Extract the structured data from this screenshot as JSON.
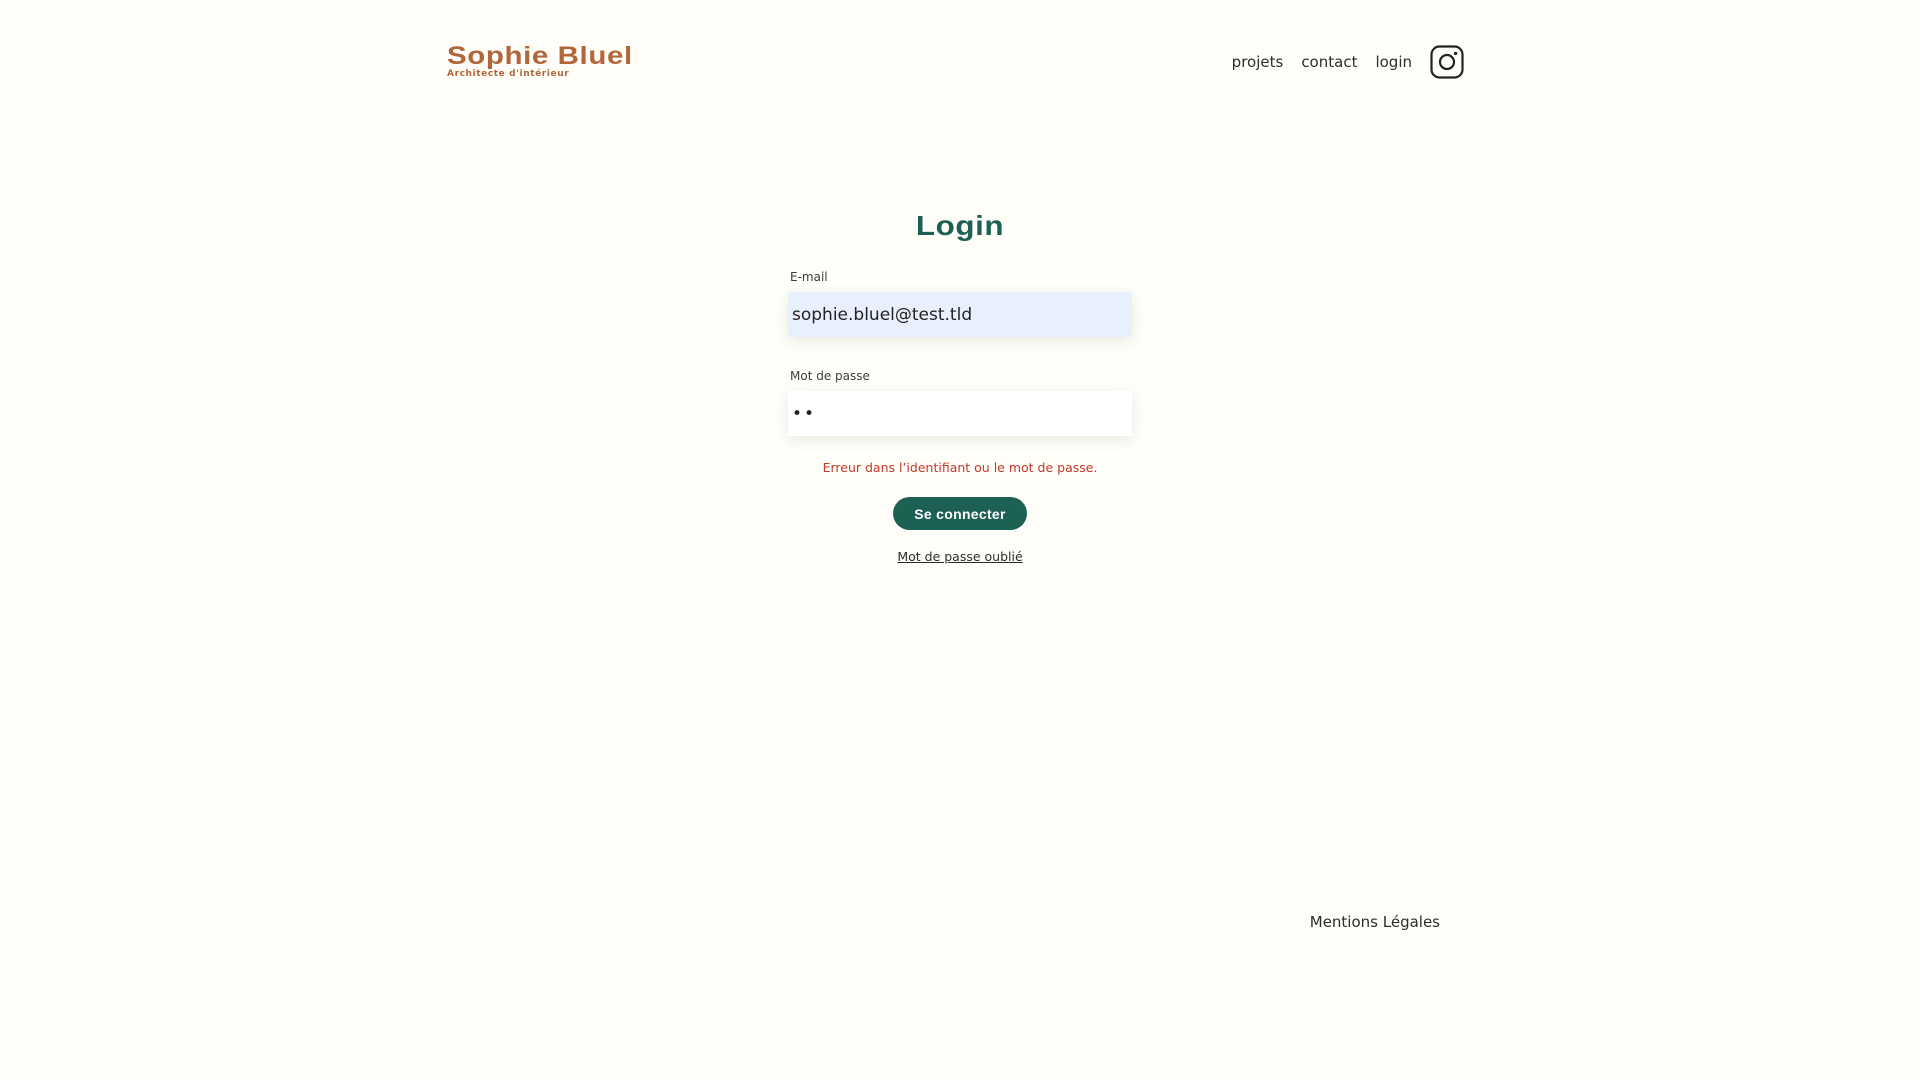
{
  "header": {
    "logo_title": "Sophie Bluel",
    "logo_subtitle": "Architecte d'intérieur",
    "nav": [
      "projets",
      "contact",
      "login"
    ],
    "instagram_icon": "instagram-icon"
  },
  "login": {
    "title": "Login",
    "email_label": "E-mail",
    "email_value": "sophie.bluel@test.tld",
    "password_label": "Mot de passe",
    "password_value": "••",
    "error_message": "Erreur dans l’identifiant ou le mot de passe.",
    "submit_label": "Se connecter",
    "forgot_link": "Mot de passe oublié"
  },
  "footer": {
    "legal_link": "Mentions Légales"
  },
  "colors": {
    "background": "#FFFEF8",
    "brand": "#B1663C",
    "accent": "#1D6154",
    "error": "#C0392B",
    "autofill": "#E8F0FE"
  }
}
